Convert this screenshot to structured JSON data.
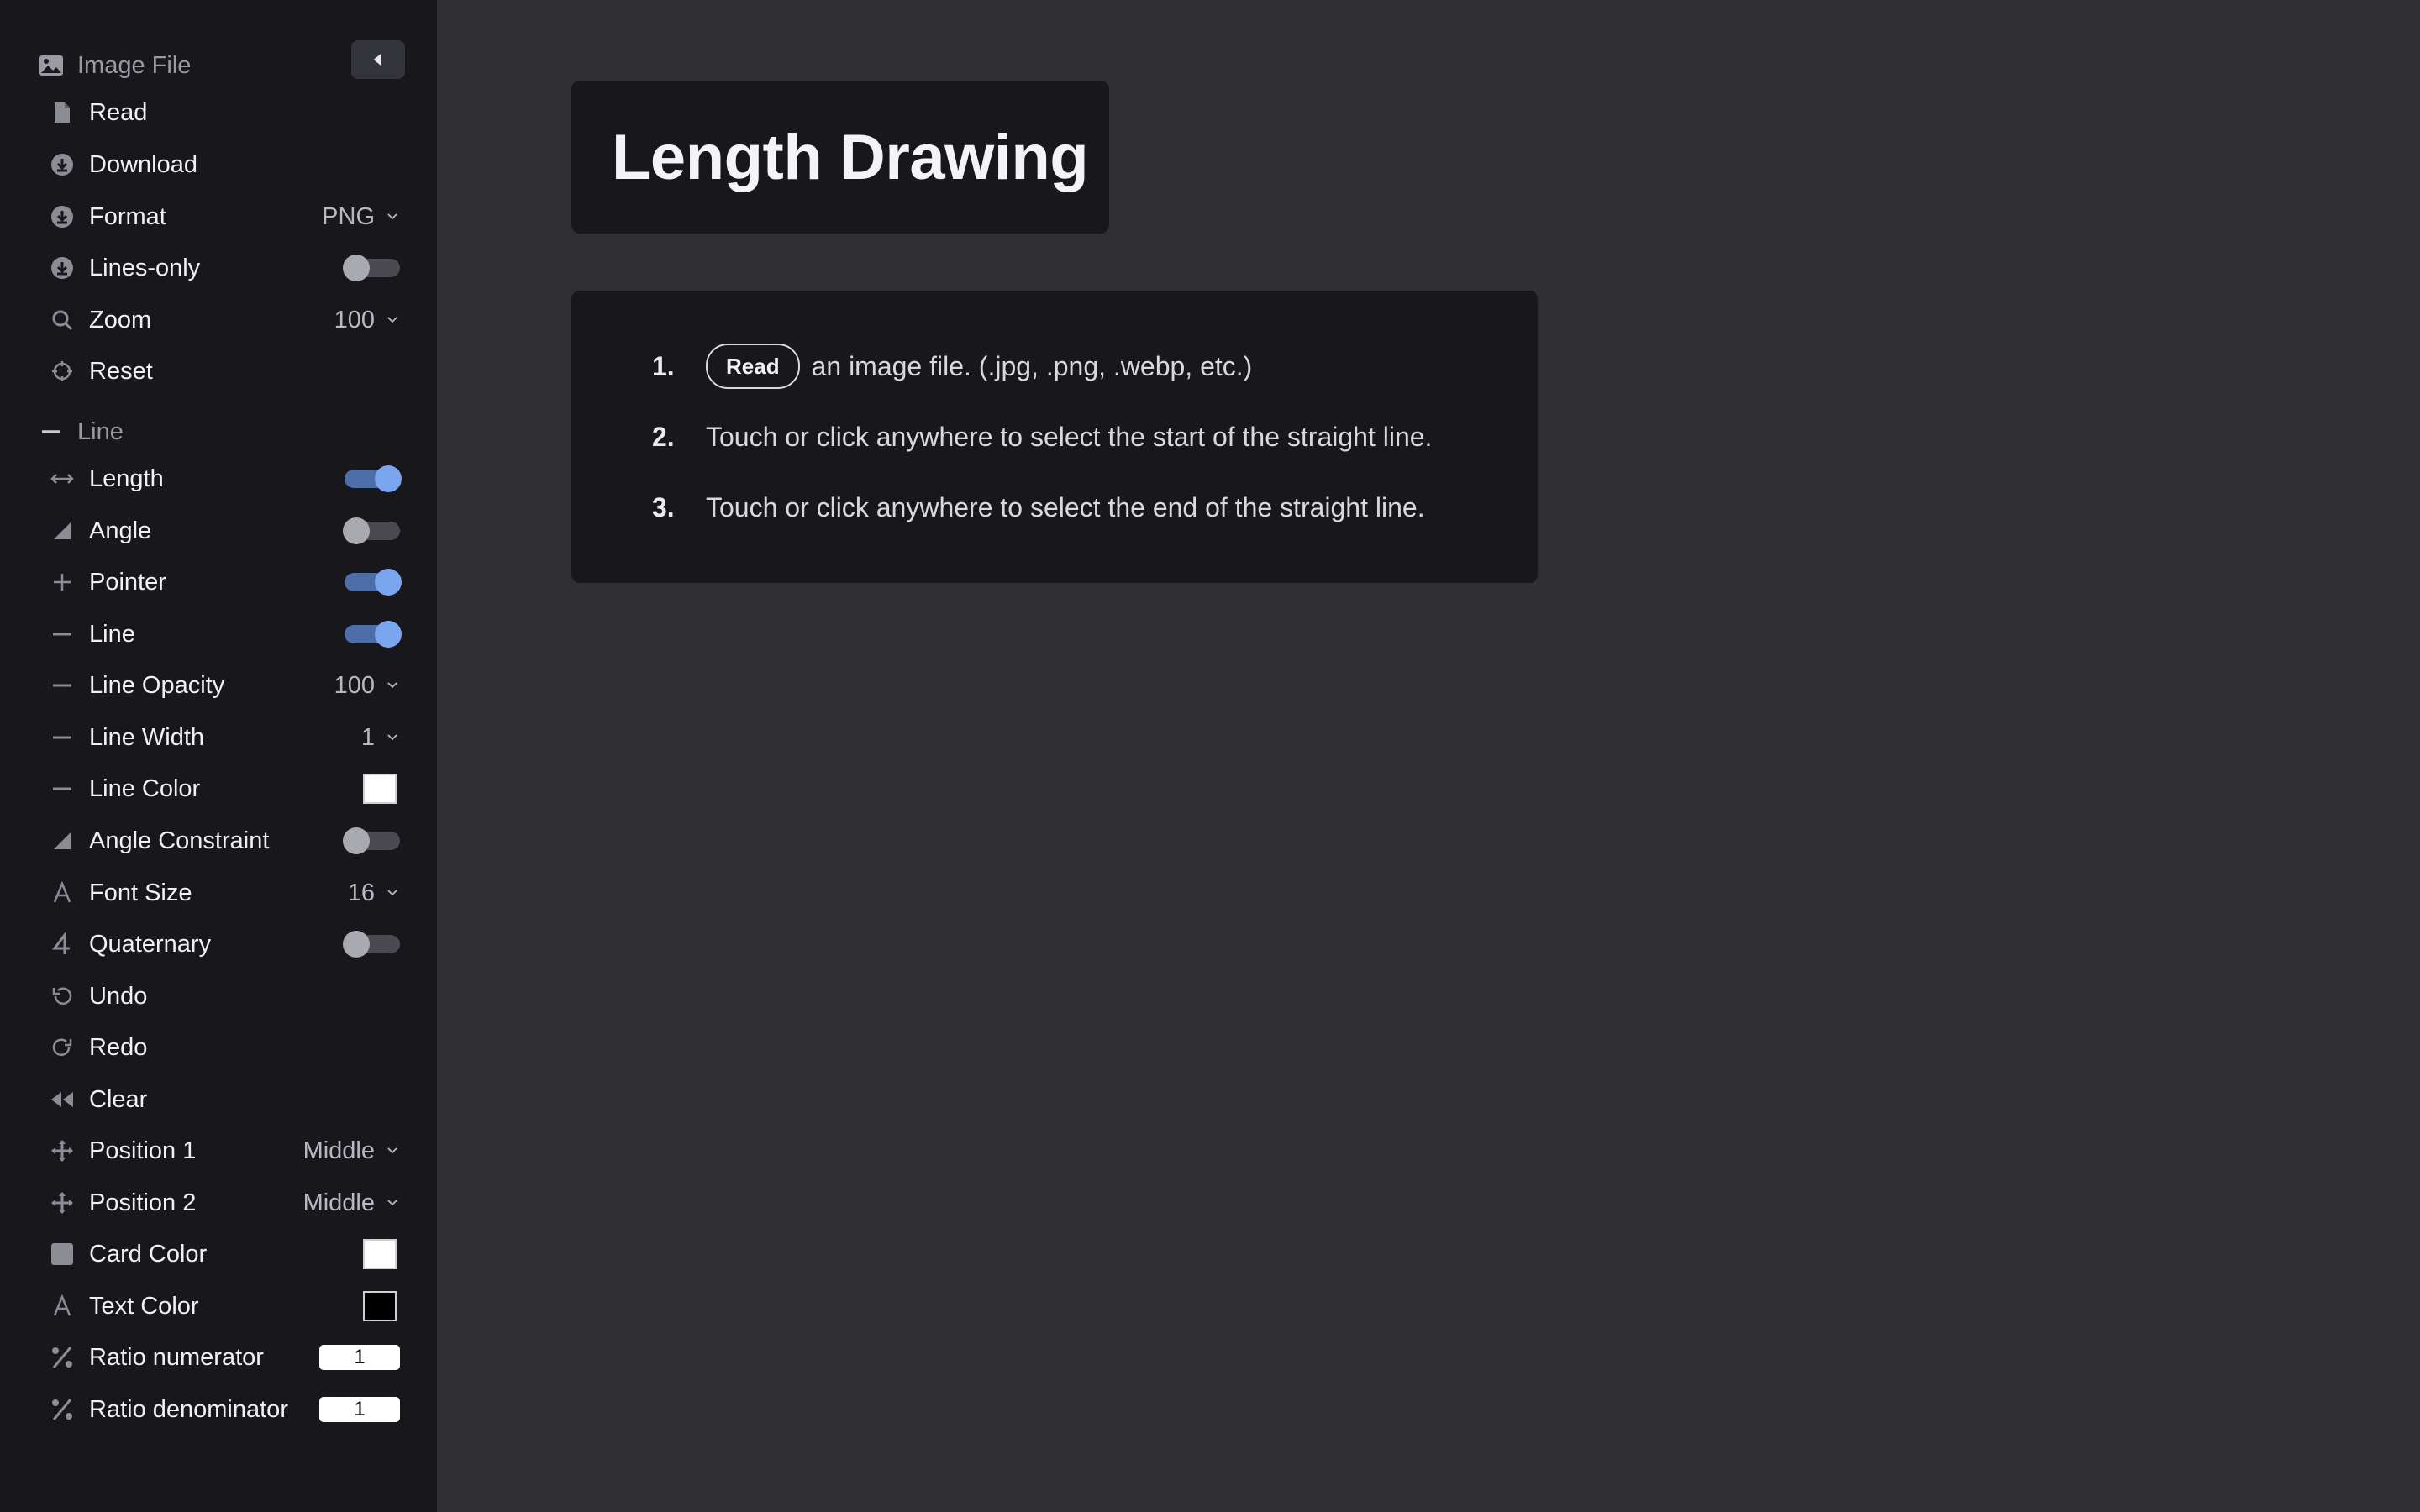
{
  "sidebar": {
    "image_file_section": {
      "header": "Image File",
      "items": [
        {
          "label": "Read",
          "icon": "file-icon"
        },
        {
          "label": "Download",
          "icon": "download-icon"
        },
        {
          "label": "Format",
          "icon": "download-icon",
          "value": "PNG"
        },
        {
          "label": "Lines-only",
          "icon": "download-icon",
          "toggle": false
        },
        {
          "label": "Zoom",
          "icon": "search-icon",
          "value": "100"
        },
        {
          "label": "Reset",
          "icon": "crosshair-icon"
        }
      ]
    },
    "line_section": {
      "header": "Line",
      "items": [
        {
          "label": "Length",
          "icon": "arrows-horizontal-icon",
          "toggle": true
        },
        {
          "label": "Angle",
          "icon": "angle-icon",
          "toggle": false
        },
        {
          "label": "Pointer",
          "icon": "plus-icon",
          "toggle": true
        },
        {
          "label": "Line",
          "icon": "minus-icon",
          "toggle": true
        },
        {
          "label": "Line Opacity",
          "icon": "minus-icon",
          "value": "100"
        },
        {
          "label": "Line Width",
          "icon": "minus-icon",
          "value": "1"
        },
        {
          "label": "Line Color",
          "icon": "minus-icon",
          "color": "#ffffff"
        },
        {
          "label": "Angle Constraint",
          "icon": "angle-icon",
          "toggle": false
        },
        {
          "label": "Font Size",
          "icon": "font-icon",
          "value": "16"
        },
        {
          "label": "Quaternary",
          "icon": "four-icon",
          "toggle": false
        },
        {
          "label": "Undo",
          "icon": "undo-icon"
        },
        {
          "label": "Redo",
          "icon": "redo-icon"
        },
        {
          "label": "Clear",
          "icon": "rewind-icon"
        },
        {
          "label": "Position 1",
          "icon": "move-icon",
          "value": "Middle"
        },
        {
          "label": "Position 2",
          "icon": "move-icon",
          "value": "Middle"
        },
        {
          "label": "Card Color",
          "icon": "square-icon",
          "color": "#ffffff"
        },
        {
          "label": "Text Color",
          "icon": "font-icon",
          "color": "#000000"
        },
        {
          "label": "Ratio numerator",
          "icon": "percent-icon",
          "input": "1"
        },
        {
          "label": "Ratio denominator",
          "icon": "percent-icon",
          "input": "1"
        }
      ]
    }
  },
  "main": {
    "title": "Length Drawing",
    "steps": [
      {
        "num": "1.",
        "button": "Read",
        "text": "an image file. (.jpg, .png, .webp, etc.)"
      },
      {
        "num": "2.",
        "text": "Touch or click anywhere to select the start of the straight line."
      },
      {
        "num": "3.",
        "text": "Touch or click anywhere to select the end of the straight line."
      }
    ]
  },
  "colors": {
    "sidebar_bg": "#17171c",
    "main_bg": "#2f2f34",
    "toggle_on": "#7aa6f0"
  }
}
